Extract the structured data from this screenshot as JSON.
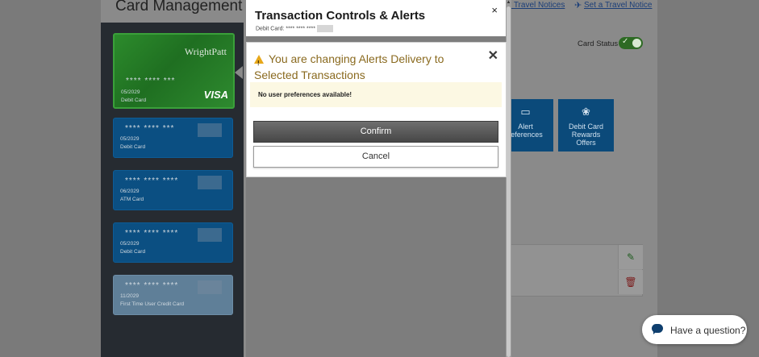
{
  "background": {
    "page_title": "Card Management",
    "links": {
      "travel_notices": "w Travel Notices",
      "set_travel_notice": "Set a Travel Notice"
    },
    "card_status_label": "Card Status",
    "cards": [
      {
        "number": "**** **** ***",
        "expiry": "05/2029",
        "type": "Debit Card",
        "brand": "VISA",
        "logo": "WrightPatt"
      },
      {
        "number": "**** **** ***",
        "expiry": "05/2029",
        "type": "Debit Card"
      },
      {
        "number": "**** **** ****",
        "expiry": "06/2029",
        "type": "ATM Card"
      },
      {
        "number": "**** **** ****",
        "expiry": "05/2029",
        "type": "Debit Card"
      },
      {
        "number": "**** **** ****",
        "expiry": "11/2029",
        "type": "First Time User Credit Card"
      }
    ],
    "tiles": [
      {
        "label": "Alert\nreferences",
        "icon": "message-icon"
      },
      {
        "label": "Debit Card\nRewards\nOffers",
        "icon": "award-ribbon-icon"
      }
    ]
  },
  "modal": {
    "title": "Transaction Controls & Alerts",
    "subtitle": "Debit Card: **** **** ****",
    "close_glyph": "×"
  },
  "alert": {
    "heading": "You are changing Alerts Delivery to Selected Transactions",
    "close_glyph": "✕",
    "notice": "No user preferences available!",
    "confirm_label": "Confirm",
    "cancel_label": "Cancel"
  },
  "chat": {
    "label": "Have a question?"
  },
  "colors": {
    "card_blue": "#0b4f82",
    "card_green": "#2c8b2c",
    "confirm_dark": "#474747",
    "warning_yellow": "#e7a81b",
    "notice_bg": "#fcf8e3"
  }
}
